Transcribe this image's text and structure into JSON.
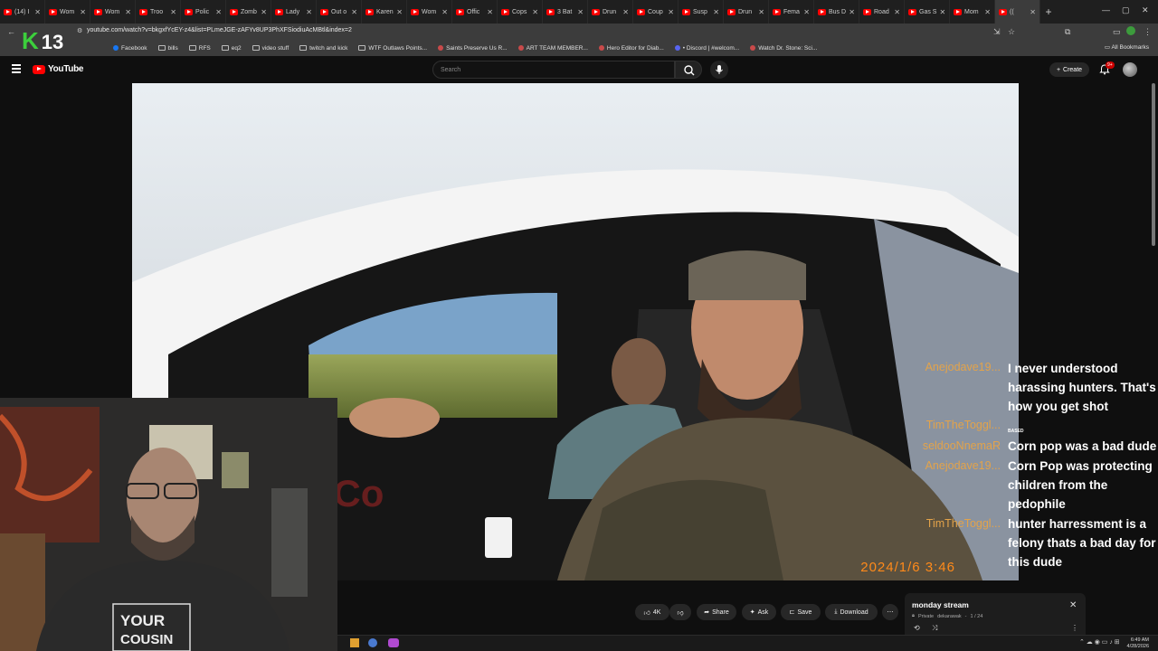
{
  "browser": {
    "tabs": [
      {
        "label": "(14) I"
      },
      {
        "label": "Wom"
      },
      {
        "label": "Wom"
      },
      {
        "label": "Troo"
      },
      {
        "label": "Polic"
      },
      {
        "label": "Zomb"
      },
      {
        "label": "Lady"
      },
      {
        "label": "Out o"
      },
      {
        "label": "Karen"
      },
      {
        "label": "Wom"
      },
      {
        "label": "Offic"
      },
      {
        "label": "Cops"
      },
      {
        "label": "3 Bat"
      },
      {
        "label": "Drun"
      },
      {
        "label": "Coup"
      },
      {
        "label": "Susp"
      },
      {
        "label": "Drun"
      },
      {
        "label": "Fema"
      },
      {
        "label": "Bus D"
      },
      {
        "label": "Road"
      },
      {
        "label": "Gas S"
      },
      {
        "label": "Mom"
      },
      {
        "label": "(("
      }
    ],
    "new_tab_label": "+",
    "url": "youtube.com/watch?v=bkgxfYcEY-z4&list=PLmeJGE-zAFYv8UP3PhXFSiodiuAcMBtl&index=2",
    "bookmarks": [
      {
        "label": "Facebook",
        "icon": "facebook-icon"
      },
      {
        "label": "bills",
        "icon": "folder-icon"
      },
      {
        "label": "RFS",
        "icon": "folder-icon"
      },
      {
        "label": "eq2",
        "icon": "folder-icon"
      },
      {
        "label": "video stuff",
        "icon": "folder-icon"
      },
      {
        "label": "twitch and kick",
        "icon": "folder-icon"
      },
      {
        "label": "WTF Outlaws Points...",
        "icon": "folder-icon"
      },
      {
        "label": "Saints Preserve Us R...",
        "icon": "site-icon"
      },
      {
        "label": "ART TEAM MEMBER...",
        "icon": "site-icon"
      },
      {
        "label": "Hero Editor for Diab...",
        "icon": "site-icon"
      },
      {
        "label": "• Discord | #welcom...",
        "icon": "discord-icon"
      },
      {
        "label": "Watch Dr. Stone: Sci...",
        "icon": "site-icon"
      }
    ],
    "all_bookmarks_label": "All Bookmarks"
  },
  "youtube": {
    "logo_text": "YouTube",
    "search_placeholder": "Search",
    "create_label": "Create",
    "notification_badge": "9+"
  },
  "video": {
    "timestamp_overlay": "2024/1/6  3:46",
    "ghost_text": "est Co"
  },
  "chat": [
    {
      "user": "Anejodave19...",
      "message": "I never understood harassing hunters. That's how you get shot"
    },
    {
      "user": "TimTheToggl...",
      "message": "Corn pop was a bad dude"
    },
    {
      "user": "seldooNnemaR",
      "message": "Corn Pop was protecting children from the pedophile"
    },
    {
      "user": "Anejodave19...",
      "message": ""
    },
    {
      "user": "TimTheToggl...",
      "message": "hunter harressment is a felony thats a bad day for this dude"
    }
  ],
  "chat_badge": "BASED",
  "overlay": {
    "k_letter": "K",
    "k_number": "13"
  },
  "actions": {
    "like_count": "4K",
    "share_label": "Share",
    "ask_label": "Ask",
    "save_label": "Save",
    "download_label": "Download"
  },
  "playlist": {
    "title": "monday stream",
    "visibility": "Private",
    "owner": "dekarawak",
    "position": "1 / 24"
  },
  "taskbar": {
    "time": "6:49 AM",
    "date": "4/28/2026"
  }
}
